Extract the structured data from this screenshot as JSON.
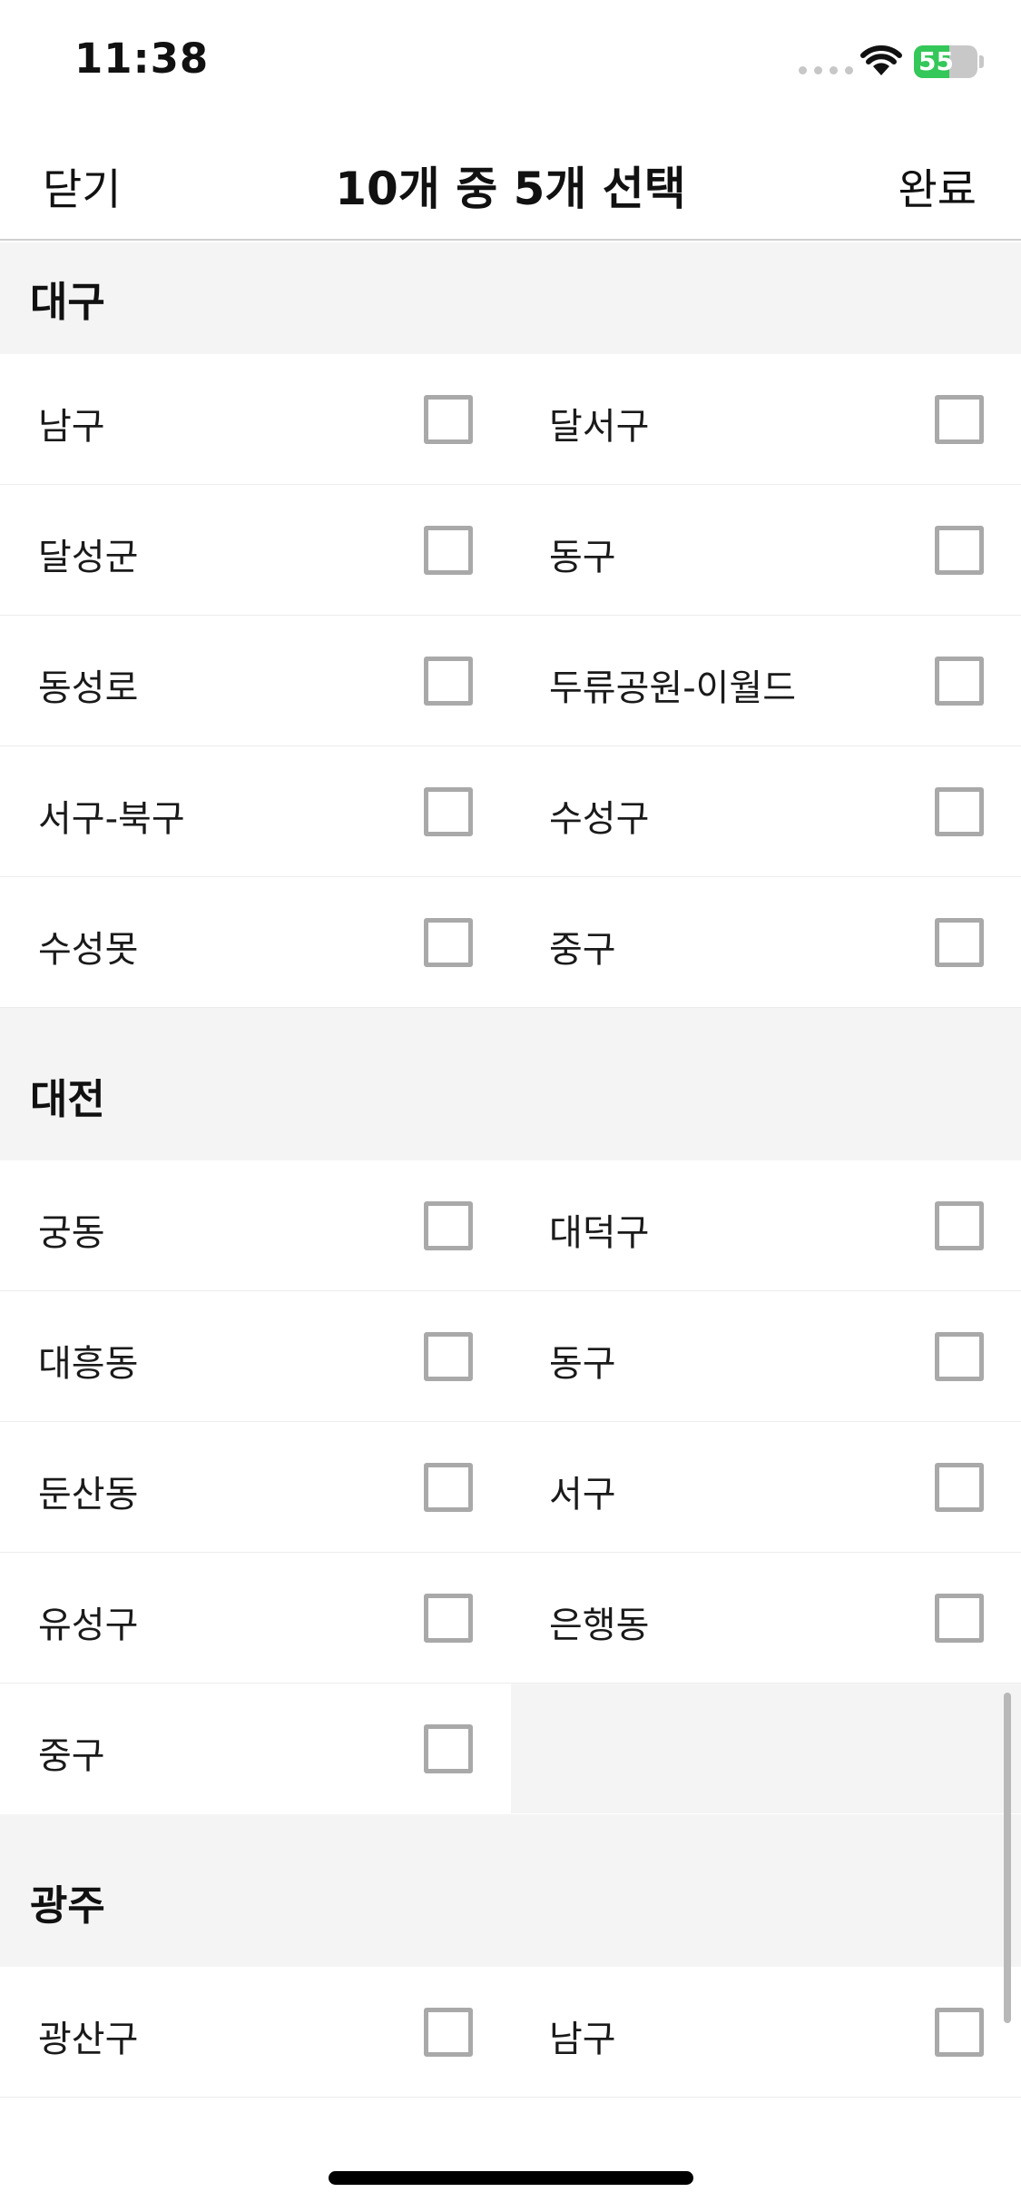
{
  "status_bar": {
    "time": "11:38",
    "battery": "55",
    "battery_level": 0.55,
    "accent_battery": "#34c759"
  },
  "nav": {
    "close_label": "닫기",
    "title": "10개 중 5개 선택",
    "done_label": "완료"
  },
  "sections": [
    {
      "title": "대구",
      "items": [
        "남구",
        "달서구",
        "달성군",
        "동구",
        "동성로",
        "두류공원-이월드",
        "서구-북구",
        "수성구",
        "수성못",
        "중구"
      ]
    },
    {
      "title": "대전",
      "items": [
        "궁동",
        "대덕구",
        "대흥동",
        "동구",
        "둔산동",
        "서구",
        "유성구",
        "은행동",
        "중구"
      ]
    },
    {
      "title": "광주",
      "items": [
        "광산구",
        "남구"
      ]
    }
  ]
}
